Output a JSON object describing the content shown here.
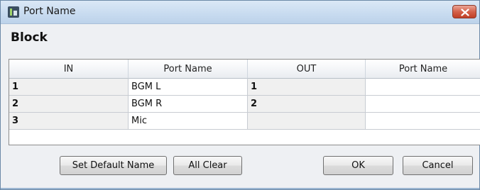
{
  "window": {
    "title": "Port Name"
  },
  "block": {
    "label": "Block"
  },
  "table": {
    "headers": [
      "IN",
      "Port Name",
      "OUT",
      "Port Name"
    ],
    "rows": [
      {
        "in": "1",
        "in_name": "BGM L",
        "out": "1",
        "out_name": ""
      },
      {
        "in": "2",
        "in_name": "BGM R",
        "out": "2",
        "out_name": ""
      },
      {
        "in": "3",
        "in_name": "Mic",
        "out": "",
        "out_name": ""
      }
    ]
  },
  "buttons": {
    "set_default_name": "Set Default Name",
    "all_clear": "All Clear",
    "ok": "OK",
    "cancel": "Cancel"
  }
}
